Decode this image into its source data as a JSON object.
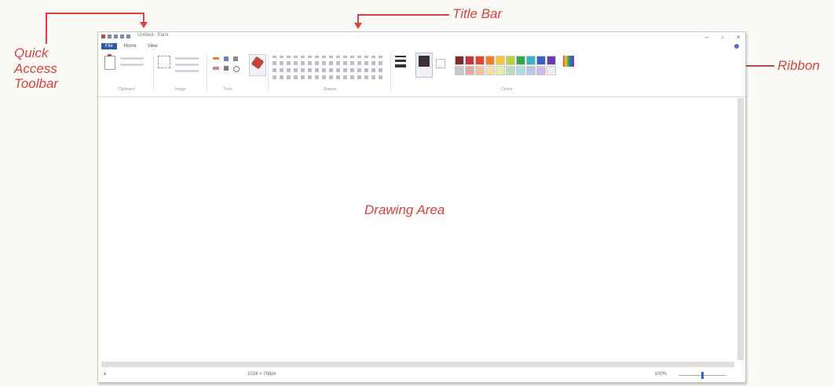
{
  "annotations": {
    "quick_access": [
      "Quick",
      "Access",
      "Toolbar"
    ],
    "title_bar": "Title Bar",
    "ribbon": "Ribbon",
    "drawing_area": "Drawing Area"
  },
  "colors": {
    "annotation": "#d9413a",
    "active_tab": "#2c5aa0"
  },
  "window": {
    "title": "Untitled - Paint",
    "buttons": {
      "minimize": "–",
      "maximize": "▫",
      "close": "×"
    },
    "tabs": [
      "File",
      "Home",
      "View"
    ],
    "ribbon_groups": [
      "Clipboard",
      "Image",
      "Tools",
      "Shapes",
      "",
      "Colors"
    ],
    "palette": [
      "#7a2e2e",
      "#c23a3a",
      "#e0452e",
      "#f07c2c",
      "#f5c53a",
      "#b7d13a",
      "#35a64a",
      "#3ab0c9",
      "#3a5fc9",
      "#6a3ab0",
      "#c7c7c7",
      "#e6a6a6",
      "#f2c2a0",
      "#f6e0a8",
      "#e6eda8",
      "#b8e0c0",
      "#b0dbe8",
      "#b8c6ec",
      "#d0b8e6",
      "#ededed"
    ],
    "status": {
      "dimensions": "1024 × 768px",
      "zoom": "100%"
    }
  }
}
